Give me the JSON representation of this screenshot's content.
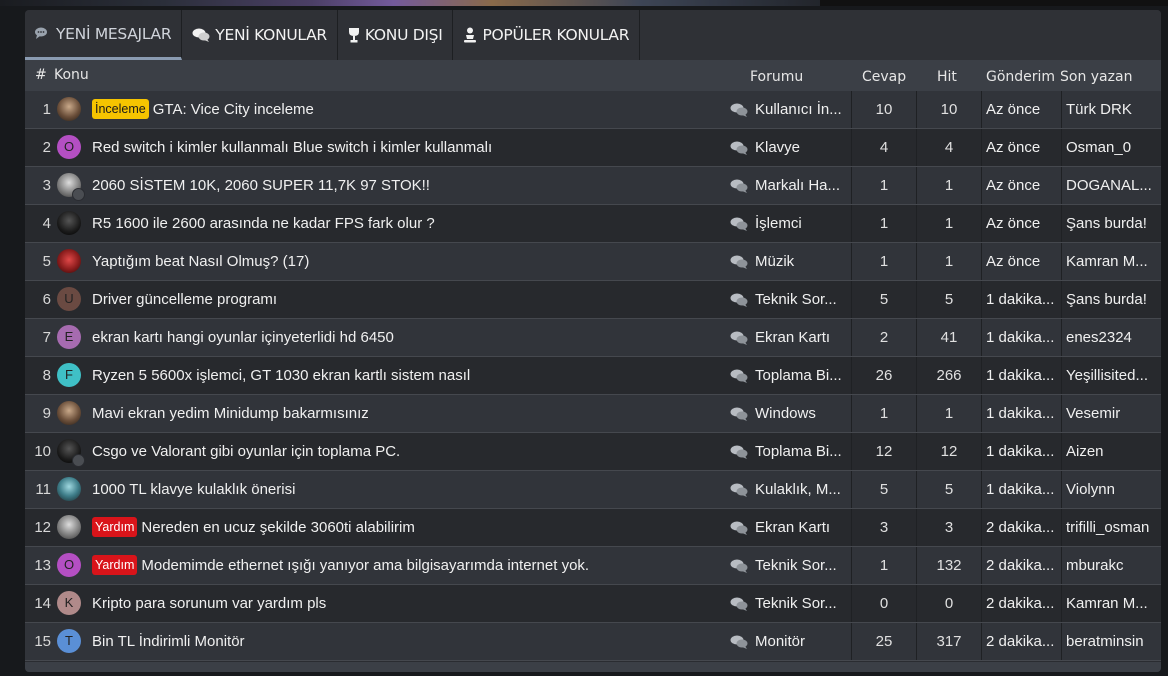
{
  "tabs": [
    {
      "label": "YENİ MESAJLAR",
      "icon": "chat-bubbles-icon",
      "active": true
    },
    {
      "label": "YENİ KONULAR",
      "icon": "chat-bubbles-icon",
      "active": false
    },
    {
      "label": "KONU DIŞI",
      "icon": "trophy-icon",
      "active": false
    },
    {
      "label": "POPÜLER KONULAR",
      "icon": "person-icon",
      "active": false
    }
  ],
  "headers": {
    "num": "#",
    "topic": "Konu",
    "forum": "Forumu",
    "replies": "Cevap",
    "hits": "Hit",
    "sent": "Gönderim",
    "last": "Son yazan"
  },
  "colors": {
    "badge_inceleme": "#f5c400",
    "badge_yardim": "#d9141a",
    "tab_active_underline": "#8a9bb1"
  },
  "rows": [
    {
      "num": "1",
      "avatar_letter": "",
      "avatar_kind": "tan",
      "badge": "İnceleme",
      "badge_kind": "yellow",
      "title": "GTA: Vice City inceleme",
      "forum": "Kullanıcı İn...",
      "replies": "10",
      "hits": "10",
      "time": "Az önce",
      "last": "Türk DRK"
    },
    {
      "num": "2",
      "avatar_letter": "O",
      "avatar_color": "#b44fc3",
      "badge": "",
      "title": "Red switch i kimler kullanmalı Blue switch i kimler kullanmalı",
      "forum": "Klavye",
      "replies": "4",
      "hits": "4",
      "time": "Az önce",
      "last": "Osman_0"
    },
    {
      "num": "3",
      "avatar_letter": "",
      "avatar_kind": "gray",
      "mini": true,
      "badge": "",
      "title": "2060 SİSTEM 10K, 2060 SUPER 11,7K 97 STOK!!",
      "forum": "Markalı Ha...",
      "replies": "1",
      "hits": "1",
      "time": "Az önce",
      "last": "DOGANAL..."
    },
    {
      "num": "4",
      "avatar_letter": "",
      "avatar_kind": "dark",
      "badge": "",
      "title": "R5 1600 ile 2600 arasında ne kadar FPS fark olur ?",
      "forum": "İşlemci",
      "replies": "1",
      "hits": "1",
      "time": "Az önce",
      "last": "Şans burda!"
    },
    {
      "num": "5",
      "avatar_letter": "",
      "avatar_kind": "red",
      "badge": "",
      "title": "Yaptığım beat Nasıl Olmuş? (17)",
      "forum": "Müzik",
      "replies": "1",
      "hits": "1",
      "time": "Az önce",
      "last": "Kamran M..."
    },
    {
      "num": "6",
      "avatar_letter": "U",
      "avatar_color": "#6a4a42",
      "badge": "",
      "title": "Driver güncelleme programı",
      "forum": "Teknik Sor...",
      "replies": "5",
      "hits": "5",
      "time": "1 dakika...",
      "last": "Şans burda!"
    },
    {
      "num": "7",
      "avatar_letter": "E",
      "avatar_color": "#a66bb0",
      "badge": "",
      "title": "ekran kartı hangi oyunlar içinyeterlidi hd 6450",
      "forum": "Ekran Kartı",
      "replies": "2",
      "hits": "41",
      "time": "1 dakika...",
      "last": "enes2324"
    },
    {
      "num": "8",
      "avatar_letter": "F",
      "avatar_color": "#3fc0c6",
      "badge": "",
      "title": "Ryzen 5 5600x işlemci, GT 1030 ekran kartlı sistem nasıl",
      "forum": "Toplama Bi...",
      "replies": "26",
      "hits": "266",
      "time": "1 dakika...",
      "last": "Yeşillisited..."
    },
    {
      "num": "9",
      "avatar_letter": "",
      "avatar_kind": "tan",
      "badge": "",
      "title": "Mavi ekran yedim Minidump bakarmısınız",
      "forum": "Windows",
      "replies": "1",
      "hits": "1",
      "time": "1 dakika...",
      "last": "Vesemir"
    },
    {
      "num": "10",
      "avatar_letter": "",
      "avatar_kind": "dark",
      "mini": true,
      "badge": "",
      "title": "Csgo ve Valorant gibi oyunlar için toplama PC.",
      "forum": "Toplama Bi...",
      "replies": "12",
      "hits": "12",
      "time": "1 dakika...",
      "last": "Aizen"
    },
    {
      "num": "11",
      "avatar_letter": "",
      "avatar_kind": "teal",
      "badge": "",
      "title": "1000 TL klavye kulaklık önerisi",
      "forum": "Kulaklık, M...",
      "replies": "5",
      "hits": "5",
      "time": "1 dakika...",
      "last": "Violynn"
    },
    {
      "num": "12",
      "avatar_letter": "",
      "avatar_kind": "gray",
      "badge": "Yardım",
      "badge_kind": "red",
      "title": "Nereden en ucuz şekilde 3060ti alabilirim",
      "forum": "Ekran Kartı",
      "replies": "3",
      "hits": "3",
      "time": "2 dakika...",
      "last": "trifilli_osman"
    },
    {
      "num": "13",
      "avatar_letter": "O",
      "avatar_color": "#b44fc3",
      "badge": "Yardım",
      "badge_kind": "red",
      "title": "Modemimde ethernet ışığı yanıyor ama bilgisayarımda internet yok.",
      "forum": "Teknik Sor...",
      "replies": "1",
      "hits": "132",
      "time": "2 dakika...",
      "last": "mburakc"
    },
    {
      "num": "14",
      "avatar_letter": "K",
      "avatar_color": "#b08a8a",
      "badge": "",
      "title": "Kripto para sorunum var yardım pls",
      "forum": "Teknik Sor...",
      "replies": "0",
      "hits": "0",
      "time": "2 dakika...",
      "last": "Kamran M..."
    },
    {
      "num": "15",
      "avatar_letter": "T",
      "avatar_color": "#5a8fd6",
      "badge": "",
      "title": "Bin TL İndirimli Monitör",
      "forum": "Monitör",
      "replies": "25",
      "hits": "317",
      "time": "2 dakika...",
      "last": "beratminsin"
    }
  ]
}
